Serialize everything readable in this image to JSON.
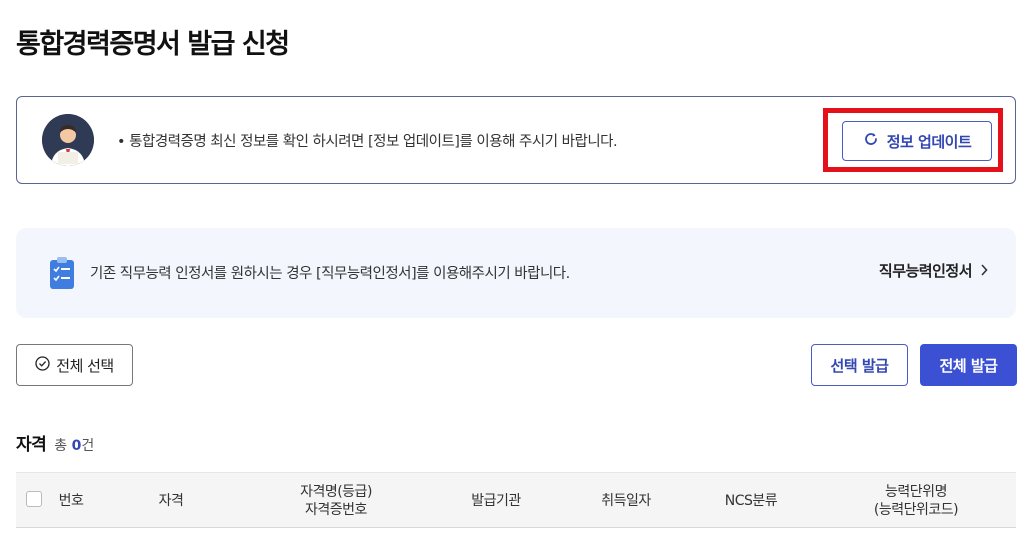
{
  "page_title": "통합경력증명서 발급 신청",
  "info": {
    "text": "• 통합경력증명 최신 정보를 확인 하시려면 [정보 업데이트]를 이용해 주시기 바랍니다.",
    "update_button_label": "정보 업데이트",
    "avatar_icon": "person-avatar-icon",
    "refresh_icon": "refresh-icon"
  },
  "notice": {
    "text": "기존 직무능력 인정서를 원하시는 경우 [직무능력인정서]를 이용해주시기 바랍니다.",
    "link_label": "직무능력인정서",
    "icon": "clipboard-checklist-icon"
  },
  "actions": {
    "select_all_label": "전체 선택",
    "issue_selected_label": "선택 발급",
    "issue_all_label": "전체 발급"
  },
  "section": {
    "title": "자격",
    "count_prefix": "총 ",
    "count_value": "0",
    "count_suffix": "건"
  },
  "table": {
    "columns": [
      [
        "번호"
      ],
      [
        "자격"
      ],
      [
        "자격명(등급)",
        "자격증번호"
      ],
      [
        "발급기관"
      ],
      [
        "취득일자"
      ],
      [
        "NCS분류"
      ],
      [
        "능력단위명",
        "(능력단위코드)"
      ]
    ]
  },
  "colors": {
    "accent": "#3c50d4",
    "highlight_border": "#e4111a",
    "notice_bg": "#f3f7fd"
  }
}
